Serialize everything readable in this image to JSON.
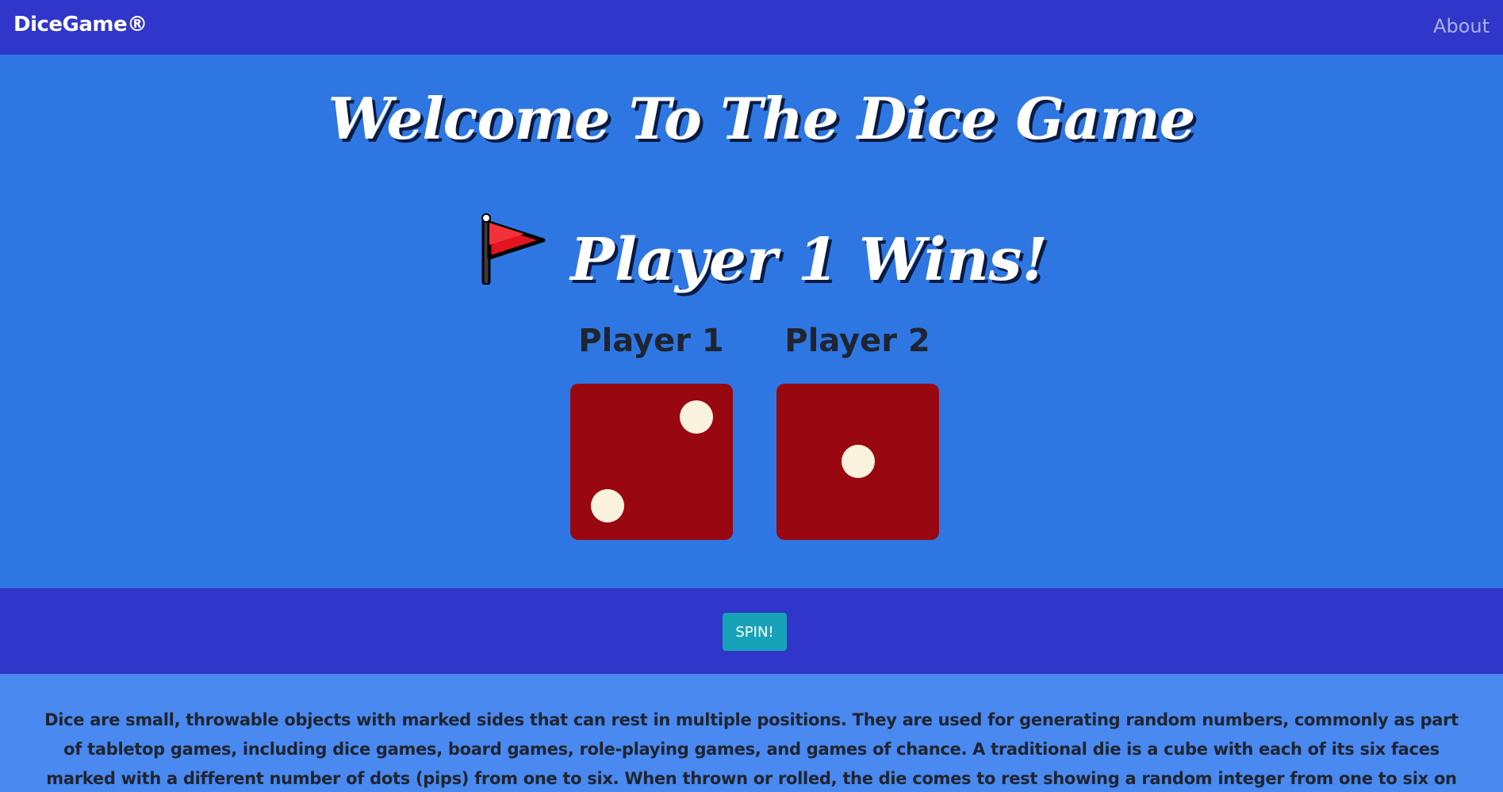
{
  "navbar": {
    "brand": "DiceGame®",
    "about_link": "About"
  },
  "hero": {
    "title": "Welcome To The Dice Game",
    "winner_text": "Player 1 Wins!",
    "winner_icon": "red-flag-icon"
  },
  "players": [
    {
      "label": "Player 1",
      "die_value": 2
    },
    {
      "label": "Player 2",
      "die_value": 1
    }
  ],
  "spin": {
    "button_label": "SPIN!"
  },
  "info": {
    "text": "Dice are small, throwable objects with marked sides that can rest in multiple positions. They are used for generating random numbers, commonly as part of tabletop games, including dice games, board games, role-playing games, and games of chance. A traditional die is a cube with each of its six faces marked with a different number of dots (pips) from one to six. When thrown or rolled, the die comes to rest showing a random integer from one to six on its upper surface, with each value being equally"
  },
  "colors": {
    "navbar": "#3036c9",
    "hero_background": "#2e77e3",
    "die_face": "#990810",
    "pip": "#fbf2de",
    "spin_button": "#17a2b8",
    "info_background": "#4a89ef"
  }
}
